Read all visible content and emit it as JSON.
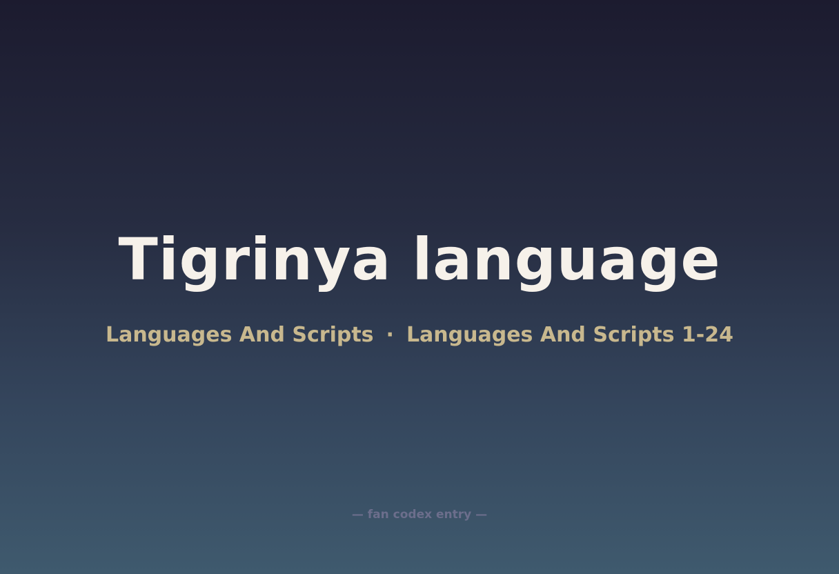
{
  "title": "Tigrinya language",
  "subtitle": {
    "category": "Languages And Scripts",
    "separator": "·",
    "collection": "Languages And Scripts 1-24"
  },
  "footer": "— fan codex entry —"
}
